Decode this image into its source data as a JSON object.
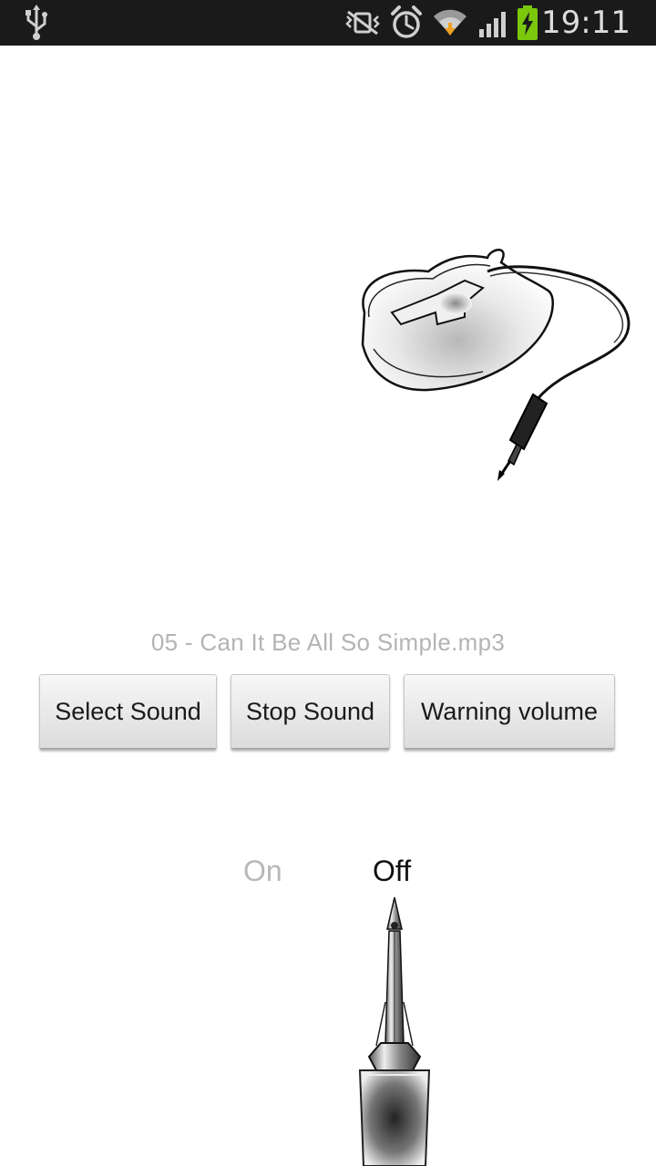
{
  "status_bar": {
    "time": "19:11",
    "icons": [
      "usb-icon",
      "vibrate-icon",
      "alarm-icon",
      "wifi-icon",
      "signal-icon",
      "battery-charging-icon"
    ]
  },
  "now_playing": {
    "filename": "05 - Can It Be All So Simple.mp3"
  },
  "buttons": {
    "select_sound": "Select Sound",
    "stop_sound": "Stop Sound",
    "warning_volume": "Warning volume"
  },
  "switch": {
    "on_label": "On",
    "off_label": "Off",
    "state": "off"
  },
  "colors": {
    "status_bar_bg": "#1a1a1a",
    "battery_green": "#7ac70c",
    "label_active": "#111111",
    "label_inactive": "#b8b8b8",
    "filename_text": "#b4b4b4"
  }
}
